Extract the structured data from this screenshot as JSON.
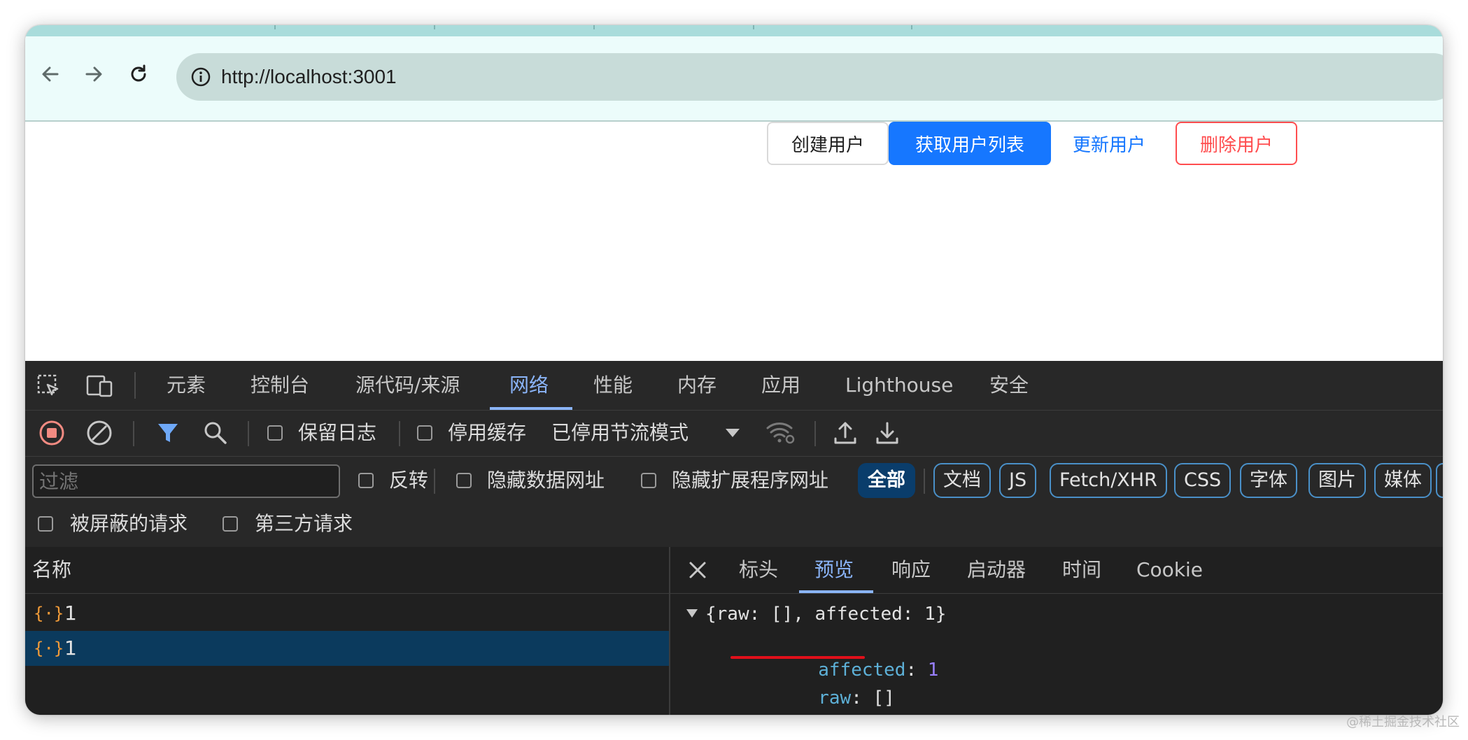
{
  "browser": {
    "url": "http://localhost:3001"
  },
  "page": {
    "buttons": {
      "create": "创建用户",
      "list": "获取用户列表",
      "update": "更新用户",
      "delete": "删除用户"
    }
  },
  "devtools": {
    "tabs": [
      "元素",
      "控制台",
      "源代码/来源",
      "网络",
      "性能",
      "内存",
      "应用",
      "Lighthouse",
      "安全"
    ],
    "active_tab": "网络",
    "network_toolbar": {
      "preserve_log": "保留日志",
      "disable_cache": "停用缓存",
      "throttling": "已停用节流模式"
    },
    "filter_bar": {
      "placeholder": "过滤",
      "invert": "反转",
      "hide_data_urls": "隐藏数据网址",
      "hide_extension_urls": "隐藏扩展程序网址",
      "types": [
        "全部",
        "文档",
        "JS",
        "Fetch/XHR",
        "CSS",
        "字体",
        "图片",
        "媒体"
      ],
      "blocked_requests": "被屏蔽的请求",
      "third_party": "第三方请求"
    },
    "request_list": {
      "header": "名称",
      "rows": [
        "1",
        "1"
      ]
    },
    "detail": {
      "tabs": [
        "标头",
        "预览",
        "响应",
        "启动器",
        "时间",
        "Cookie"
      ],
      "active_tab": "预览",
      "preview": {
        "summary": "{raw: [], affected: 1}",
        "affected_key": "affected",
        "affected_value": "1",
        "raw_key": "raw",
        "raw_value": "[]"
      }
    }
  },
  "watermark": "@稀土掘金技术社区",
  "colors": {
    "primary": "#1677ff",
    "danger": "#ff4d4f",
    "devtools_accent": "#8ab4f8",
    "highlight_underline": "#e0101a"
  }
}
